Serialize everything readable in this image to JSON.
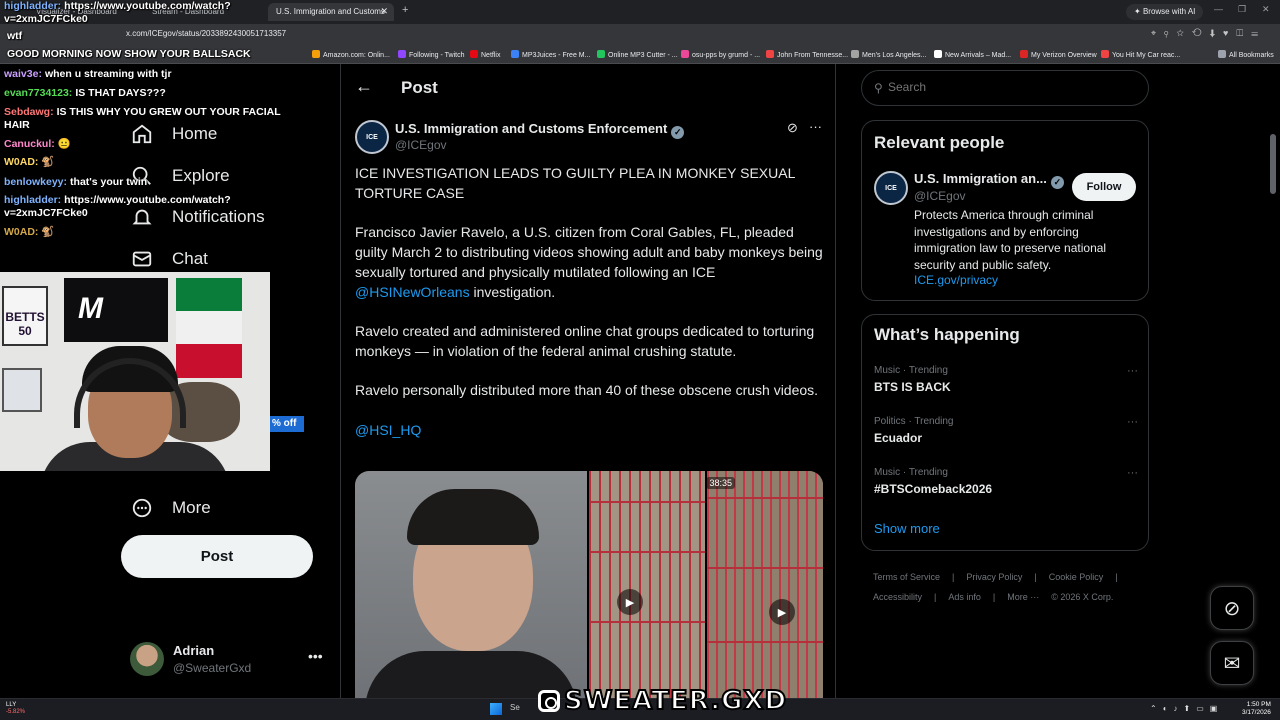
{
  "browser": {
    "tabs": [
      {
        "title": "Visualizer - Dashboard"
      },
      {
        "title": "Stream - Dashboard"
      },
      {
        "title": "U.S. Immigration and Customs",
        "active": true
      }
    ],
    "new_tab": "+",
    "browse_ai": "Browse with AI",
    "url": "x.com/ICEgov/status/2033892430051713357",
    "bookmarks": [
      "Amazon.com: Onlin...",
      "Following - Twitch",
      "Netflix",
      "MP3Juices - Free M...",
      "Online MP3 Cutter - ...",
      "osu-pps by grumd - ...",
      "John From Tennesse...",
      "Men's Los Angeles...",
      "New Arrivals – Mad...",
      "My Verizon Overview",
      "You Hit My Car reac...",
      "All Bookmarks"
    ],
    "bookmark_colors": [
      "#f59e0b",
      "#9146ff",
      "#e50914",
      "#3b82f6",
      "#22c55e",
      "#ec4899",
      "#ef4444",
      "#a3a3a3",
      "#ffffff",
      "#dc2626",
      "#ef4444",
      "#9ca3af"
    ]
  },
  "nav": {
    "items": [
      {
        "label": "Home",
        "icon": "home-icon"
      },
      {
        "label": "Explore",
        "icon": "search-icon"
      },
      {
        "label": "Notifications",
        "icon": "bell-icon"
      },
      {
        "label": "Chat",
        "icon": "mail-icon"
      },
      {
        "label": "More",
        "icon": "more-circle-icon"
      }
    ],
    "post_button": "Post",
    "account": {
      "name": "Adrian",
      "handle": "@SweaterGxd"
    }
  },
  "main": {
    "header_title": "Post",
    "tweet": {
      "author_name": "U.S. Immigration and Customs Enforcement",
      "author_handle": "@ICEgov",
      "avatar_text": "ICE",
      "paragraphs": [
        "ICE INVESTIGATION LEADS TO GUILTY PLEA IN MONKEY SEXUAL TORTURE CASE",
        "Francisco Javier Ravelo, a U.S. citizen from Coral Gables, FL, pleaded guilty March 2 to distributing videos showing adult and baby monkeys being sexually tortured and physically mutilated following an ICE",
        "Ravelo created and administered online chat groups dedicated to torturing monkeys — in violation of the federal animal crushing statute.",
        "Ravelo personally distributed more than 40 of these obscene crush videos."
      ],
      "mention_1": "@HSINewOrleans",
      "after_mention_1": " investigation.",
      "mention_2": "@HSI_HQ",
      "video_duration": "38:35"
    }
  },
  "sidebar": {
    "search_placeholder": "Search",
    "relevant_people": {
      "title": "Relevant people",
      "name": "U.S. Immigration an...",
      "handle": "@ICEgov",
      "follow": "Follow",
      "bio": "Protects America through criminal investigations and by enforcing immigration law to preserve national security and public safety.",
      "link": "ICE.gov/privacy"
    },
    "whats_happening": {
      "title": "What’s happening",
      "trends": [
        {
          "category": "Music · Trending",
          "title": "BTS IS BACK"
        },
        {
          "category": "Politics · Trending",
          "title": "Ecuador"
        },
        {
          "category": "Music · Trending",
          "title": "#BTSComeback2026"
        }
      ],
      "show_more": "Show more"
    },
    "footer": [
      "Terms of Service",
      "|",
      "Privacy Policy",
      "|",
      "Cookie Policy",
      "|",
      "Accessibility",
      "|",
      "Ads info",
      "|",
      "More ···",
      "© 2026 X Corp."
    ]
  },
  "stream_chat": [
    {
      "user": "highladder:",
      "color": "#7fb3ff",
      "msg": "https://www.youtube.com/watch?v=2xmJC7FCke0"
    },
    {
      "user": "",
      "color": "#ff5555",
      "msg": "wtf"
    },
    {
      "user": "",
      "color": "#b58cff",
      "msg": "GOOD MORNING NOW SHOW YOUR BALLSACK"
    },
    {
      "user": "waiv3e:",
      "color": "#c9a0ff",
      "msg": "when u streaming with tjr"
    },
    {
      "user": "evan7734123:",
      "color": "#55dd55",
      "msg": "IS THAT DAYS???"
    },
    {
      "user": "Sebdawg:",
      "color": "#ff7777",
      "msg": "IS THIS WHY YOU GREW OUT YOUR FACIAL HAIR"
    },
    {
      "user": "Canuckul:",
      "color": "#ff88cc",
      "msg": "😐"
    },
    {
      "user": "W0AD:",
      "color": "#ffd966",
      "msg": "🐒"
    },
    {
      "user": "benlowkeyy:",
      "color": "#7fb3ff",
      "msg": "that's your twin"
    },
    {
      "user": "highladder:",
      "color": "#7fb3ff",
      "msg": "https://www.youtube.com/watch?v=2xmJC7FCke0"
    },
    {
      "user": "W0AD:",
      "color": "#d4a94a",
      "msg": "🐒"
    }
  ],
  "webcam": {
    "jersey_text": "BETTS 50",
    "sign_text": "M"
  },
  "overlay_discount": "% off",
  "watermark": "SWEATER.GXD",
  "taskbar": {
    "ticker": "LLY",
    "ticker_change": "-5.82%",
    "search": "Se",
    "time": "1:50 PM",
    "date": "3/17/2026"
  }
}
